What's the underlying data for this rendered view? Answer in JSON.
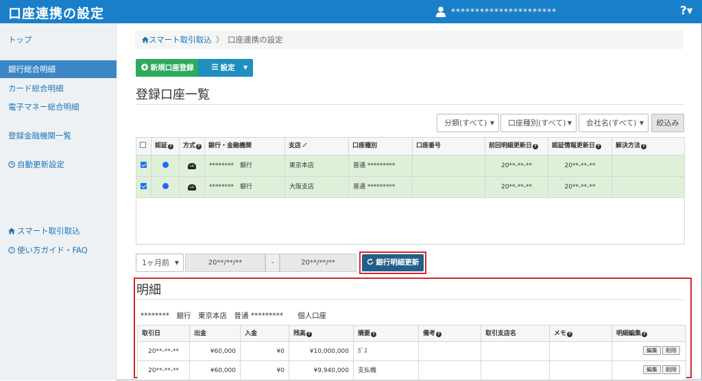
{
  "header": {
    "title": "口座連携の設定",
    "user_name": "**********************",
    "help_label": "?▾"
  },
  "sidebar": {
    "items": [
      {
        "label": "トップ"
      },
      {
        "label": "銀行総合明細"
      },
      {
        "label": "カード総合明細"
      },
      {
        "label": "電子マネー総合明細"
      },
      {
        "label": "登録金融機関一覧"
      },
      {
        "label": "自動更新設定"
      },
      {
        "label": "スマート取引取込"
      },
      {
        "label": "使い方ガイド・FAQ"
      }
    ]
  },
  "breadcrumb": {
    "home": "スマート取引取込",
    "separator": "》",
    "current": "口座連携の設定"
  },
  "toolbar": {
    "new_account": "新規口座登録",
    "settings": "設定"
  },
  "accounts": {
    "title": "登録口座一覧",
    "filters": [
      {
        "label": "分類(すべて)"
      },
      {
        "label": "口座種別(すべて)"
      },
      {
        "label": "会社名(すべて)"
      }
    ],
    "filter_button": "絞込み",
    "columns": [
      "認証",
      "方式",
      "銀行・金融機関",
      "支店",
      "口座種別",
      "口座番号",
      "前回明細更新日",
      "認証情報更新日",
      "解決方法"
    ],
    "rows": [
      {
        "bank": "********　銀行",
        "branch": "東京本店",
        "type": "普通 *********",
        "number": "",
        "last_update": "20**-**-**",
        "auth_update": "20**-**-**",
        "resolve": "",
        "method": "API"
      },
      {
        "bank": "********　銀行",
        "branch": "大阪支店",
        "type": "普通 *********",
        "number": "",
        "last_update": "20**-**-**",
        "auth_update": "20**-**-**",
        "resolve": "",
        "method": "API"
      }
    ]
  },
  "date_range": {
    "period": "1ヶ月前",
    "from": "20**/**/**",
    "separator": "-",
    "to": "20**/**/**",
    "update_button": "銀行明細更新"
  },
  "detail": {
    "title": "明細",
    "account_info": "********　銀行　東京本店　普通 *********　　個人口座",
    "columns": [
      "取引日",
      "出金",
      "入金",
      "残高",
      "摘要",
      "備考",
      "取引支店名",
      "メモ",
      "明細編集"
    ],
    "rows": [
      {
        "date": "20**-**-**",
        "withdrawal": "¥60,000",
        "deposit": "¥0",
        "balance": "¥10,000,000",
        "summary": "ｶﾞｽ",
        "note": "",
        "branch": "",
        "memo": ""
      },
      {
        "date": "20**-**-**",
        "withdrawal": "¥60,000",
        "deposit": "¥0",
        "balance": "¥9,940,000",
        "summary": "支払機",
        "note": "",
        "branch": "",
        "memo": ""
      }
    ],
    "edit_label": "編集",
    "delete_label": "削除"
  }
}
